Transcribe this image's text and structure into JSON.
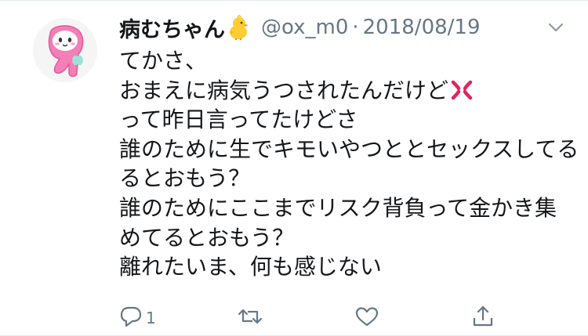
{
  "user": {
    "display_name": "病むちゃん",
    "name_emoji": "chick-emoji",
    "handle": "@ox_m0",
    "separator": "·",
    "date": "2018/08/19"
  },
  "tweet": {
    "lines": [
      "てかさ、",
      "おまえに病気うつされたんだけど",
      "って昨日言ってたけどさ",
      "誰のために生でキモいやつととセックスしてる",
      "るとおもう？",
      "誰のためにここまでリスク背負って金かき集",
      "めてるとおもう？",
      "離れたいま、何も感じない"
    ],
    "inline_emoji": "anger-symbol-emoji"
  },
  "actions": {
    "reply_count": "1",
    "icons": [
      "reply-icon",
      "retweet-icon",
      "like-icon",
      "share-icon"
    ]
  },
  "colors": {
    "text": "#14171a",
    "secondary": "#657786",
    "avatar_pink": "#f47eb6",
    "anger_red": "#e0245e"
  }
}
